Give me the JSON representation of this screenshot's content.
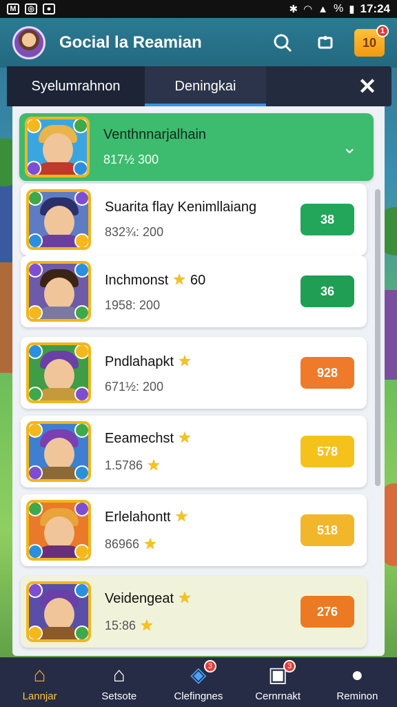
{
  "status_bar": {
    "time": "17:24",
    "battery": "%",
    "left_icons": [
      "gmail-icon",
      "photos-icon",
      "app-icon"
    ],
    "right_icons": [
      "bluetooth-icon",
      "wifi-icon",
      "signal-icon",
      "battery-icon"
    ]
  },
  "header": {
    "title": "Gocial la Reamian",
    "gift_badge": "1",
    "gift_label": "10"
  },
  "tabs": {
    "tab1": "Syelumrahnon",
    "tab2": "Deningkai"
  },
  "rows": [
    {
      "name": "Venthnnarjalhain",
      "sub": "817½ 300",
      "style": "selected",
      "button": "",
      "button_color": "",
      "stars_name": false,
      "stars_sub": false,
      "palette": {
        "hair": "#e9b44a",
        "body": "#c0392b",
        "bg": "#3aa6e0"
      }
    },
    {
      "name": "Suarita flay Kenimllaiang",
      "sub": "832¾: 200",
      "style": "normal",
      "button": "38",
      "button_color": "#22a65a",
      "stars_name": false,
      "stars_sub": false,
      "palette": {
        "hair": "#2b2f6a",
        "body": "#6b3fa0",
        "bg": "#5d7cc4"
      }
    },
    {
      "name": "Inchmonst",
      "name_suffix": "60",
      "sub": "1958: 200",
      "style": "normal",
      "button": "36",
      "button_color": "#1f9e54",
      "stars_name": true,
      "stars_sub": false,
      "palette": {
        "hair": "#3a2415",
        "body": "#7a7aa0",
        "bg": "#6d5aa8"
      }
    },
    {
      "name": "Pndlahapkt",
      "sub": "671½: 200",
      "style": "normal",
      "button": "928",
      "button_color": "#ee7a2a",
      "stars_name": true,
      "stars_sub": false,
      "palette": {
        "hair": "#6a3fa8",
        "body": "#c49a3a",
        "bg": "#3f9d45"
      }
    },
    {
      "name": "Eeamechst",
      "sub": "1.5786",
      "style": "normal",
      "button": "578",
      "button_color": "#f5c21c",
      "stars_name": true,
      "stars_sub": true,
      "palette": {
        "hair": "#7a3fb0",
        "body": "#8a6a3a",
        "bg": "#3f7fd0"
      }
    },
    {
      "name": "Erlelahontt",
      "sub": "86966",
      "style": "normal",
      "button": "518",
      "button_color": "#f2b62a",
      "stars_name": true,
      "stars_sub": true,
      "palette": {
        "hair": "#e8a43a",
        "body": "#6a2f7a",
        "bg": "#e87a2a"
      }
    },
    {
      "name": "Veidengeat",
      "sub": "15:86",
      "style": "highlight",
      "button": "276",
      "button_color": "#ec7a22",
      "stars_name": true,
      "stars_sub": true,
      "palette": {
        "hair": "#6a3fa8",
        "body": "#8a5a2a",
        "bg": "#5a4fa8"
      }
    }
  ],
  "nav": [
    {
      "label": "Lannjar",
      "icon": "home-icon",
      "active": true,
      "badge": ""
    },
    {
      "label": "Setsote",
      "icon": "house-icon",
      "active": false,
      "badge": ""
    },
    {
      "label": "Clefingnes",
      "icon": "game-icon",
      "active": false,
      "badge": "3"
    },
    {
      "label": "Cernrnakt",
      "icon": "camera-icon",
      "active": false,
      "badge": "3"
    },
    {
      "label": "Reminon",
      "icon": "user-icon",
      "active": false,
      "badge": ""
    }
  ]
}
